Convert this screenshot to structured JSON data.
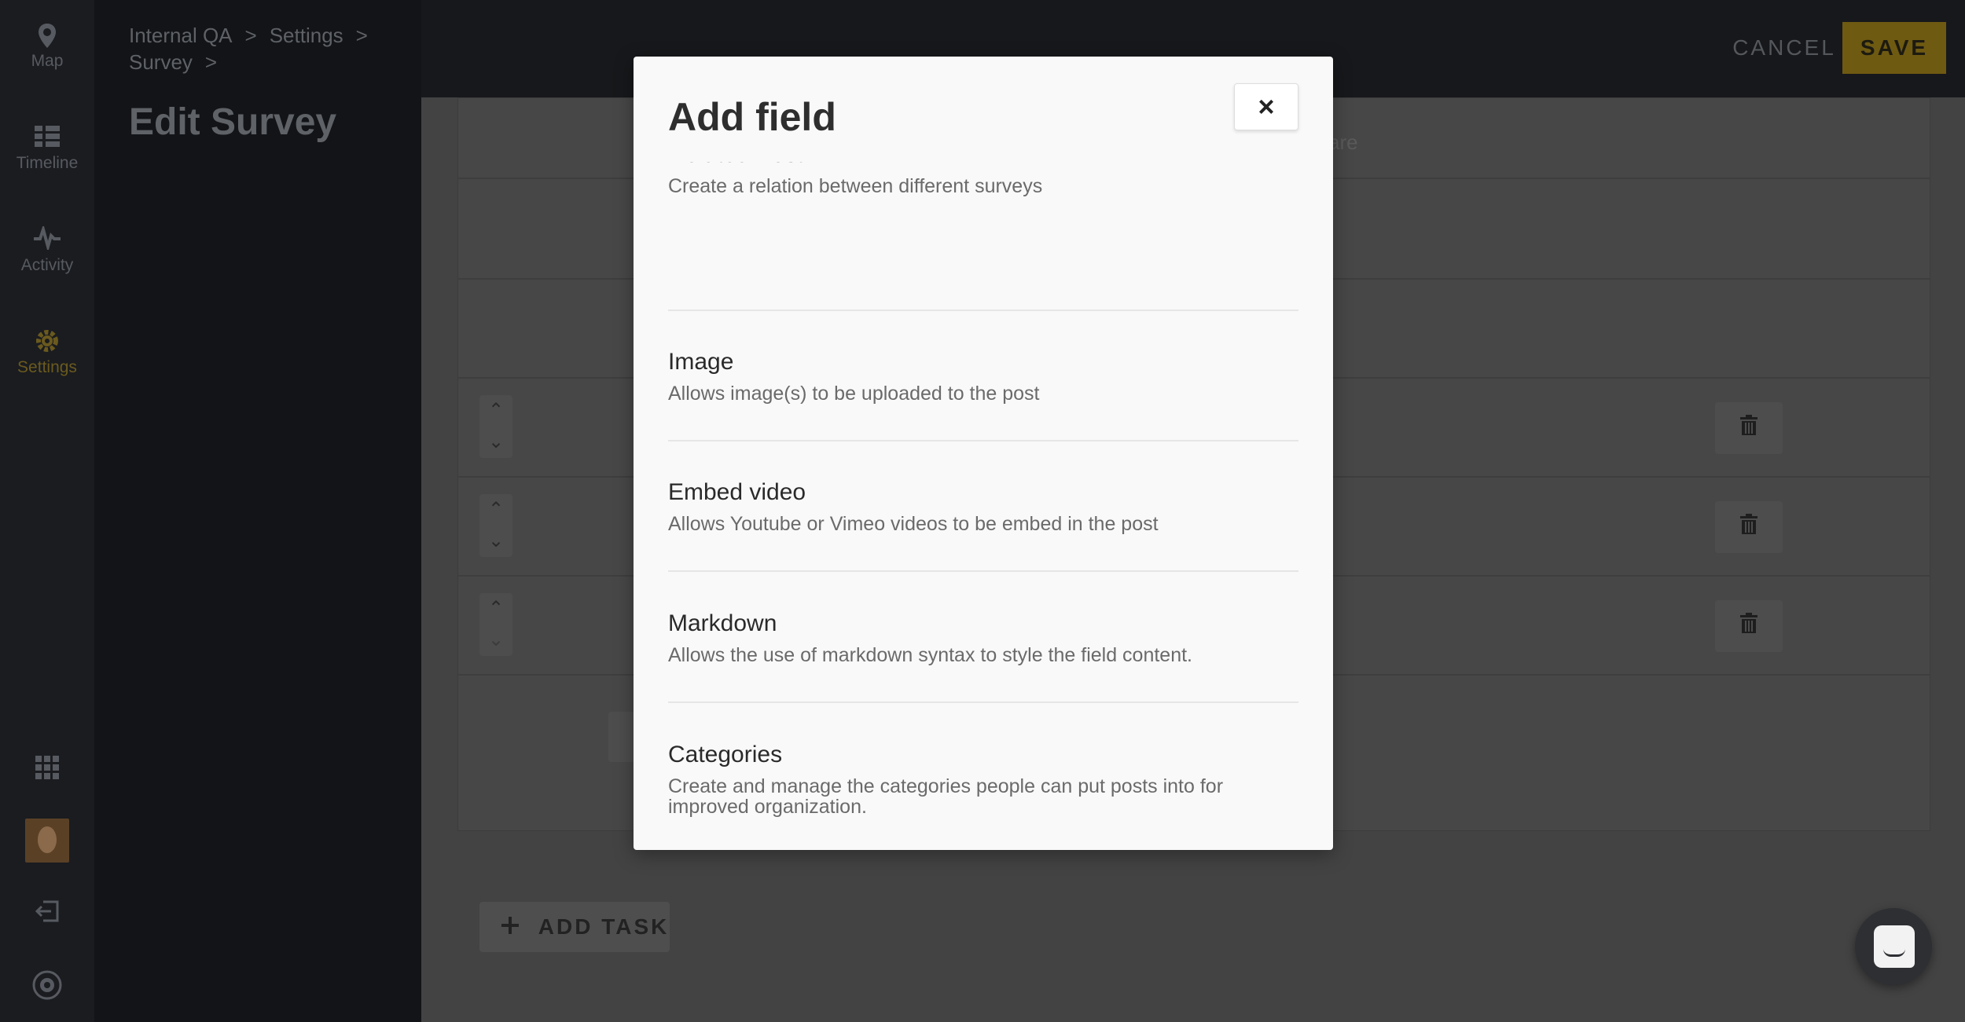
{
  "nav": {
    "items": [
      {
        "label": "Map",
        "icon": "map-pin-icon"
      },
      {
        "label": "Timeline",
        "icon": "timeline-icon"
      },
      {
        "label": "Activity",
        "icon": "activity-icon"
      },
      {
        "label": "Settings",
        "icon": "gear-icon"
      }
    ],
    "bottom_icons": [
      "apps-grid-icon",
      "user-avatar",
      "logout-icon",
      "help-globe-icon"
    ],
    "active_color": "#6b5a1e"
  },
  "panel": {
    "breadcrumb": [
      "Internal QA",
      "Settings",
      "Survey"
    ],
    "breadcrumb_sep": ">",
    "title": "Edit Survey"
  },
  "topbar": {
    "cancel_label": "CANCEL",
    "save_label": "SAVE",
    "save_color": "#6f5a12"
  },
  "background": {
    "partial_text": "are",
    "add_task_label": "ADD TASK"
  },
  "modal": {
    "title": "Add field",
    "close_label": "×",
    "field_types": [
      {
        "name": "Related Post",
        "description": "Create a relation between different surveys"
      },
      {
        "name": "Image",
        "description": "Allows image(s) to be uploaded to the post"
      },
      {
        "name": "Embed video",
        "description": "Allows Youtube or Vimeo videos to be embed in the post"
      },
      {
        "name": "Markdown",
        "description": "Allows the use of markdown syntax to style the field content."
      },
      {
        "name": "Categories",
        "description": "Create and manage the categories people can put posts into for improved organization."
      }
    ]
  }
}
